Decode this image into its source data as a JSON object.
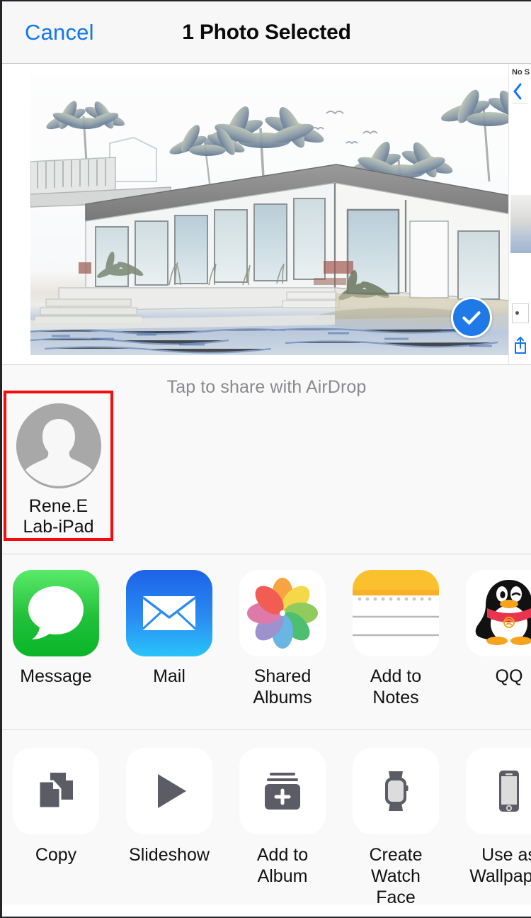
{
  "header": {
    "cancel_label": "Cancel",
    "title": "1 Photo Selected"
  },
  "preview": {
    "photo_alt": "pencil-sketch rendering of a mid-century modern house with palm trees and a pool",
    "selected": true,
    "badge_icon": "checkmark-icon",
    "badge_color": "#1f7ae8",
    "edge_sliver": {
      "status_text": "No S",
      "back_icon": "chevron-left-icon",
      "share_icon": "share-icon"
    }
  },
  "airdrop": {
    "hint": "Tap to share with AirDrop",
    "highlight_color": "#f50b0b",
    "contacts": [
      {
        "name": "Rene.E\nLab-iPad",
        "avatar_icon": "person-placeholder-icon",
        "highlighted": true
      }
    ]
  },
  "apps": {
    "items": [
      {
        "label": "Message",
        "icon": "messages-icon"
      },
      {
        "label": "Mail",
        "icon": "mail-icon"
      },
      {
        "label": "Shared\nAlbums",
        "icon": "photos-icon"
      },
      {
        "label": "Add to Notes",
        "icon": "notes-icon"
      },
      {
        "label": "QQ",
        "icon": "qq-icon"
      }
    ]
  },
  "actions": {
    "items": [
      {
        "label": "Copy",
        "icon": "copy-icon"
      },
      {
        "label": "Slideshow",
        "icon": "play-icon"
      },
      {
        "label": "Add to Album",
        "icon": "add-to-album-icon"
      },
      {
        "label": "Create\nWatch Face",
        "icon": "watch-icon"
      },
      {
        "label": "Use as\nWallpaper",
        "icon": "iphone-icon"
      }
    ]
  },
  "colors": {
    "tint": "#1175f2",
    "panel_bg": "#f9f9f9",
    "header_bg": "#f7f7f7",
    "separator": "#d4d4d4",
    "glyph_gray": "#5c5c66"
  }
}
